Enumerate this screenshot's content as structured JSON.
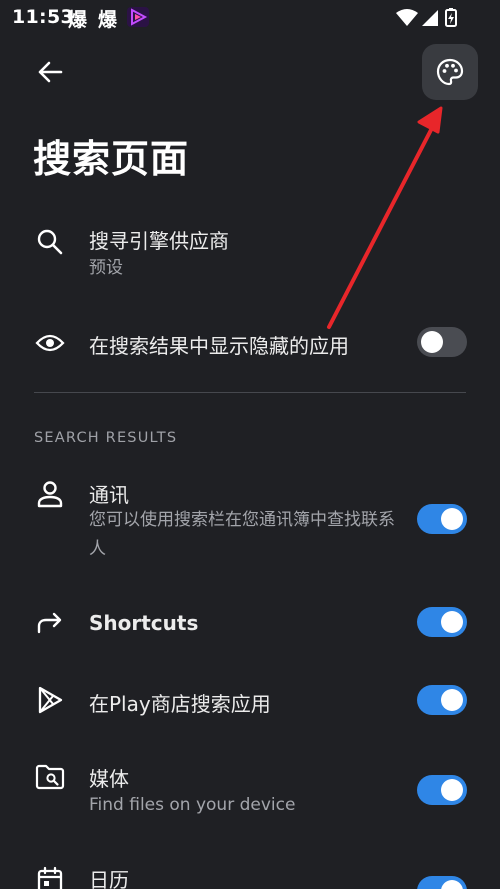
{
  "status_bar": {
    "time": "11:53",
    "notif_1": "爆",
    "notif_2": "爆"
  },
  "header": {
    "title": "搜索页面",
    "back_icon": "arrow-left-icon",
    "palette_icon": "palette-icon"
  },
  "settings": {
    "search_engine": {
      "title": "搜寻引擎供应商",
      "subtitle": "预设",
      "icon": "search-icon"
    },
    "show_hidden": {
      "title": "在搜索结果中显示隐藏的应用",
      "icon": "eye-icon",
      "enabled": false
    }
  },
  "section_header": "SEARCH RESULTS",
  "results": {
    "contacts": {
      "title": "通讯",
      "subtitle": "您可以使用搜索栏在您通讯簿中查找联系人",
      "icon": "person-icon",
      "enabled": true
    },
    "shortcuts": {
      "title": "Shortcuts",
      "icon": "share-arrow-icon",
      "enabled": true
    },
    "play_store": {
      "title": "在Play商店搜索应用",
      "icon": "play-store-icon",
      "enabled": true
    },
    "media": {
      "title": "媒体",
      "subtitle": "Find files on your device",
      "icon": "folder-search-icon",
      "enabled": true
    },
    "calendar": {
      "title": "日历",
      "icon": "calendar-icon",
      "enabled": true
    }
  },
  "colors": {
    "background": "#1f2024",
    "accent": "#2f86e6",
    "annotation": "#e8262a"
  }
}
